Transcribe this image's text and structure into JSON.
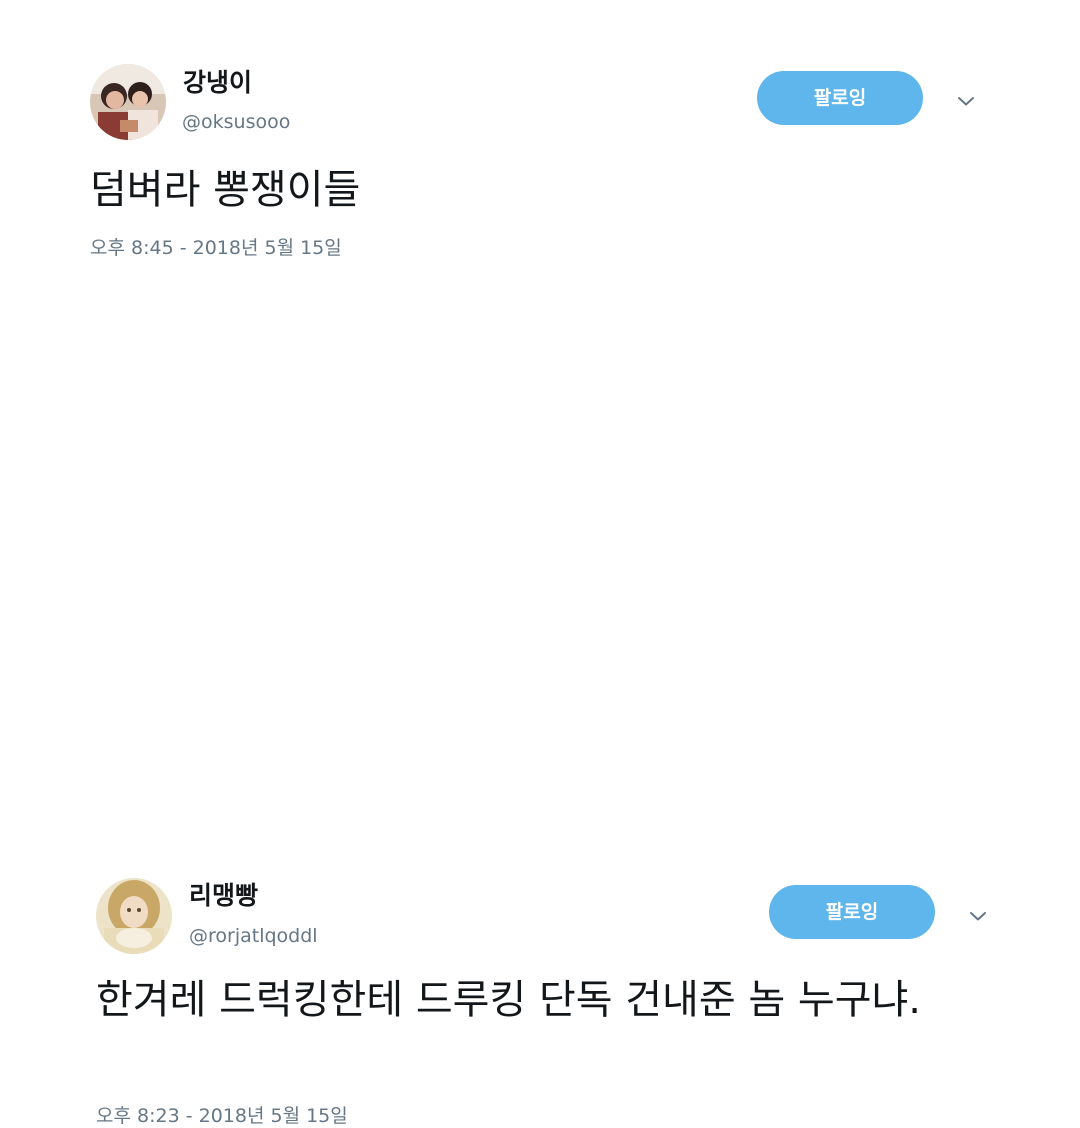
{
  "tweets": [
    {
      "display_name": "강냉이",
      "handle": "@oksusooo",
      "follow_label": "팔로잉",
      "text": "덤벼라 뽕쟁이들",
      "timestamp": "오후 8:45 - 2018년 5월 15일",
      "avatar_icon": "user-avatar-photo",
      "caret_icon": "chevron-down-icon"
    },
    {
      "display_name": "리맹빵",
      "handle": "@rorjatlqoddl",
      "follow_label": "팔로잉",
      "text": "한겨레 드럭킹한테 드루킹 단독 건내준 놈 누구냐.",
      "timestamp": "오후 8:23 - 2018년 5월 15일",
      "avatar_icon": "user-avatar-photo",
      "caret_icon": "chevron-down-icon"
    }
  ],
  "colors": {
    "follow_button": "#5fb6ec",
    "name": "#14171a",
    "secondary_text": "#657786",
    "background": "#ffffff"
  }
}
